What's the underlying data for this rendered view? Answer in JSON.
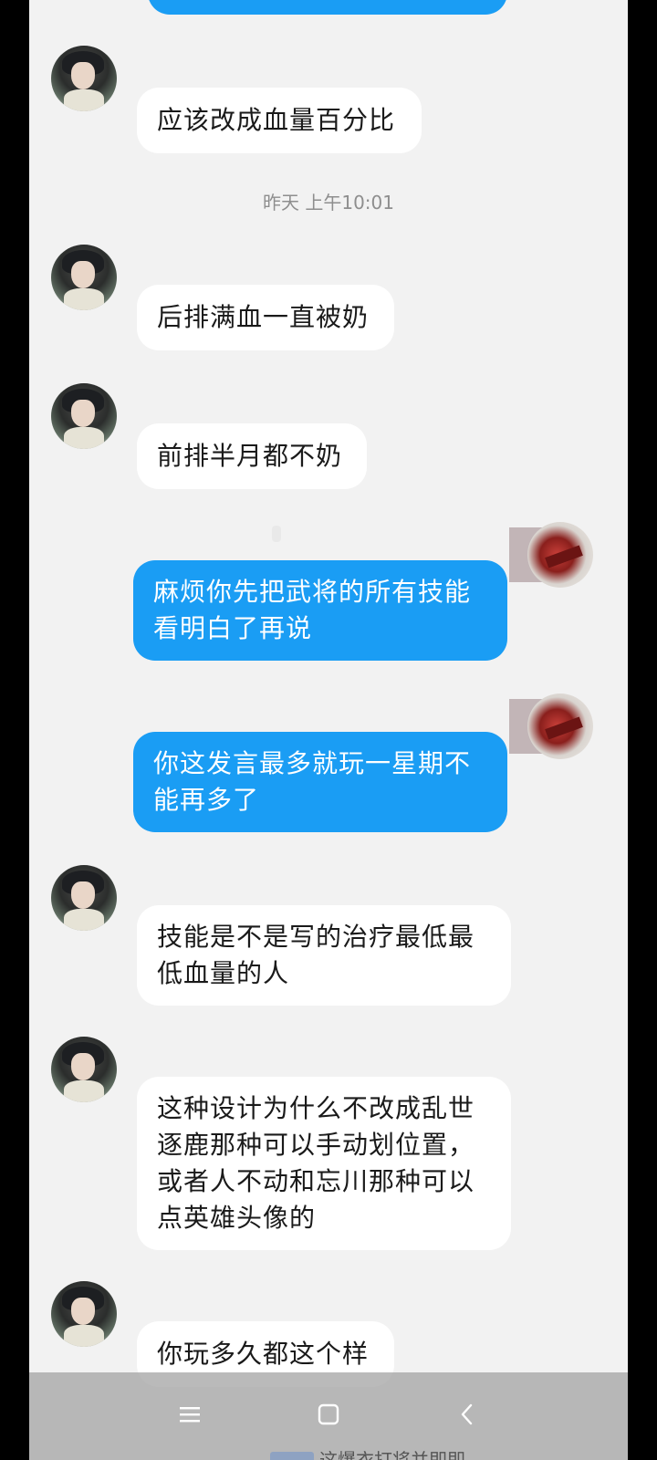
{
  "messages": [
    {
      "side": "in",
      "text": "应该改成血量百分比"
    },
    {
      "side": "in",
      "text": "后排满血一直被奶"
    },
    {
      "side": "in",
      "text": "前排半月都不奶"
    },
    {
      "side": "out",
      "text": "麻烦你先把武将的所有技能\n看明白了再说"
    },
    {
      "side": "out",
      "text": "你这发言最多就玩一星期不\n能再多了"
    },
    {
      "side": "in",
      "text": "技能是不是写的治疗最低最\n低血量的人"
    },
    {
      "side": "in",
      "text": "这种设计为什么不改成乱世\n逐鹿那种可以手动划位置，\n或者人不动和忘川那种可以\n点英雄头像的"
    },
    {
      "side": "in",
      "text": "你玩多久都这个样"
    }
  ],
  "timestamp": "昨天 上午10:01",
  "bottom_peek_text": "这爆衣打将并即即",
  "nav": {
    "menu_icon": "menu-icon",
    "home_icon": "home-icon",
    "back_icon": "back-icon"
  },
  "colors": {
    "out_bubble": "#1a9df4",
    "in_bubble": "#ffffff",
    "background": "#f2f2f2"
  }
}
